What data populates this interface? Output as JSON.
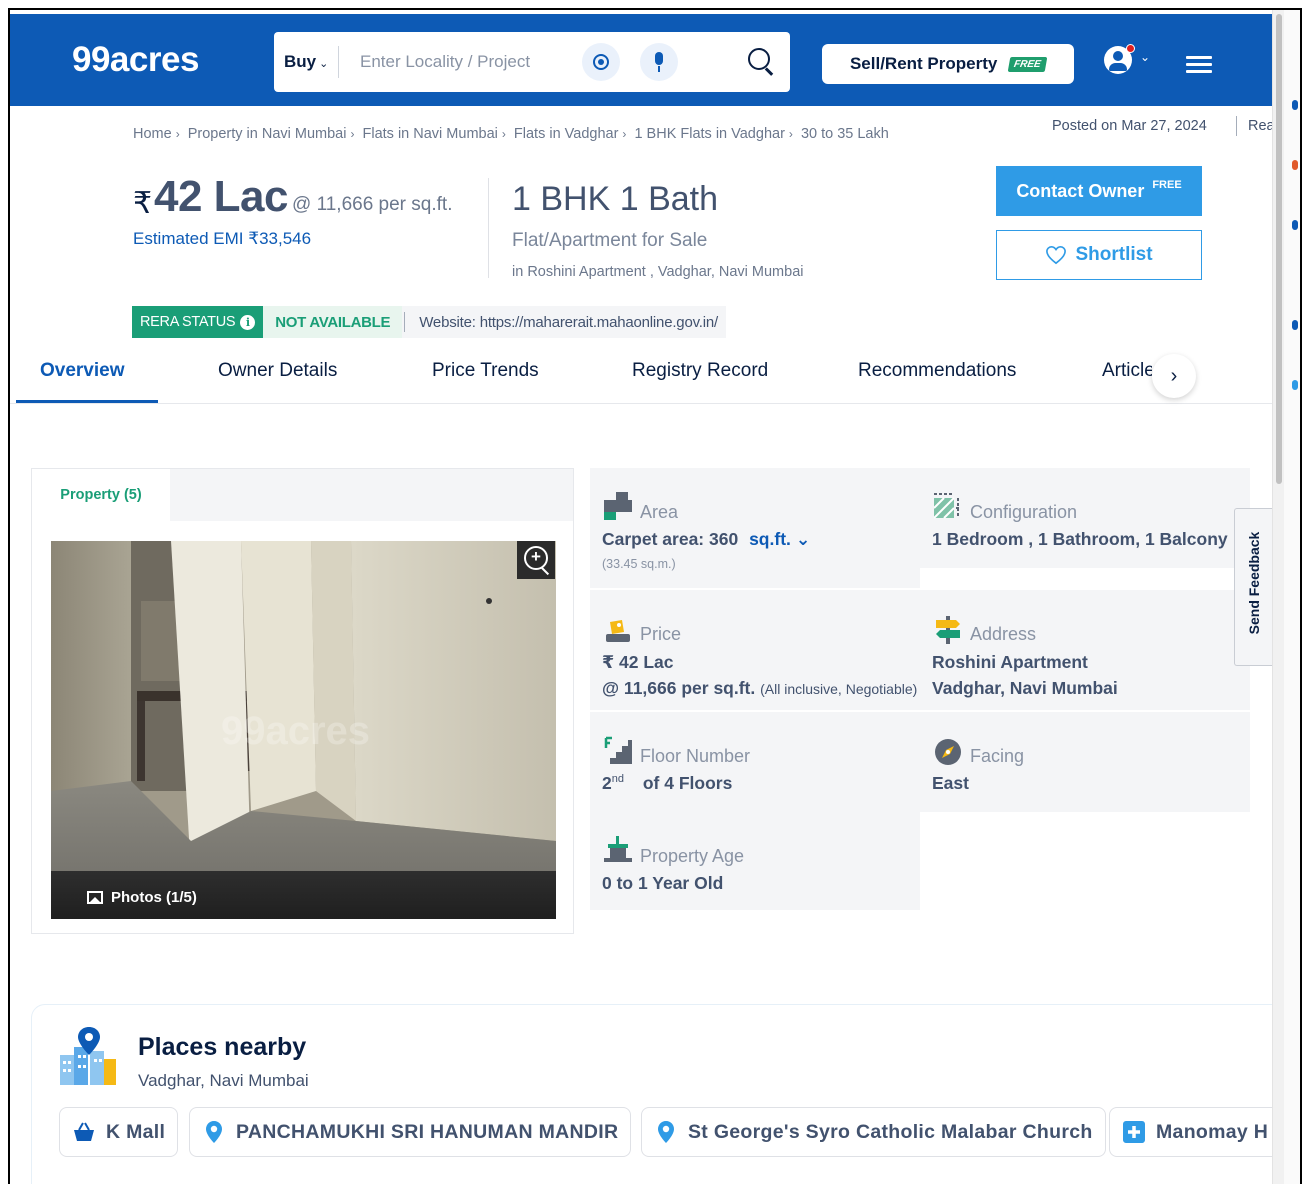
{
  "header": {
    "logo": "99acres",
    "search": {
      "category": "Buy",
      "placeholder": "Enter Locality / Project"
    },
    "sell_button": "Sell/Rent Property",
    "sell_badge": "FREE",
    "brand_color": "#0d5ab5"
  },
  "breadcrumb": [
    "Home",
    "Property in Navi Mumbai",
    "Flats in Navi Mumbai",
    "Flats in Vadghar",
    "1 BHK Flats in Vadghar",
    "30 to 35 Lakh"
  ],
  "posted": "Posted on Mar 27, 2024",
  "posted_extra": "Rea",
  "listing": {
    "currency": "₹",
    "price": "42 Lac",
    "price_per_sqft": "@ 11,666 per sq.ft.",
    "emi": "Estimated EMI ₹33,546",
    "config_title": "1 BHK 1 Bath",
    "type": "Flat/Apartment for Sale",
    "location": "in Roshini Apartment , Vadghar, Navi Mumbai",
    "contact_button": "Contact Owner",
    "contact_badge": "FREE",
    "shortlist_button": "Shortlist"
  },
  "rera": {
    "status_label": "RERA STATUS",
    "info_glyph": "i",
    "status_value": "NOT AVAILABLE",
    "website": "Website: https://maharerait.mahaonline.gov.in/"
  },
  "tabs": [
    "Overview",
    "Owner Details",
    "Price Trends",
    "Registry Record",
    "Recommendations",
    "Articles"
  ],
  "tab_next_glyph": "›",
  "gallery": {
    "tab": "Property (5)",
    "watermark": "99acres",
    "photo_caption": "Photos (1/5)"
  },
  "details": {
    "area": {
      "label": "Area",
      "value": "Carpet area: 360",
      "unit": "sq.ft.",
      "sub": "(33.45 sq.m.)"
    },
    "configuration": {
      "label": "Configuration",
      "value": "1 Bedroom , 1 Bathroom, 1 Balcony"
    },
    "price": {
      "label": "Price",
      "value": "₹ 42 Lac",
      "per_sqft": "@ 11,666 per sq.ft.",
      "note": "(All inclusive, Negotiable)"
    },
    "address": {
      "label": "Address",
      "line1": "Roshini Apartment",
      "line2": "Vadghar, Navi Mumbai"
    },
    "floor": {
      "label": "Floor Number",
      "number": "2",
      "suffix": "nd",
      "of": "of 4 Floors"
    },
    "facing": {
      "label": "Facing",
      "value": "East"
    },
    "age": {
      "label": "Property Age",
      "value": "0 to 1 Year Old"
    }
  },
  "feedback": "Send Feedback",
  "places": {
    "title": "Places nearby",
    "subtitle": "Vadghar, Navi Mumbai",
    "chips": [
      {
        "label": "K Mall",
        "icon": "shopping-basket-icon"
      },
      {
        "label": "PANCHAMUKHI SRI HANUMAN MANDIR",
        "icon": "map-pin-icon"
      },
      {
        "label": "St George's Syro Catholic Malabar Church",
        "icon": "map-pin-icon"
      },
      {
        "label": "Manomay H",
        "icon": "hospital-cross-icon"
      }
    ]
  }
}
